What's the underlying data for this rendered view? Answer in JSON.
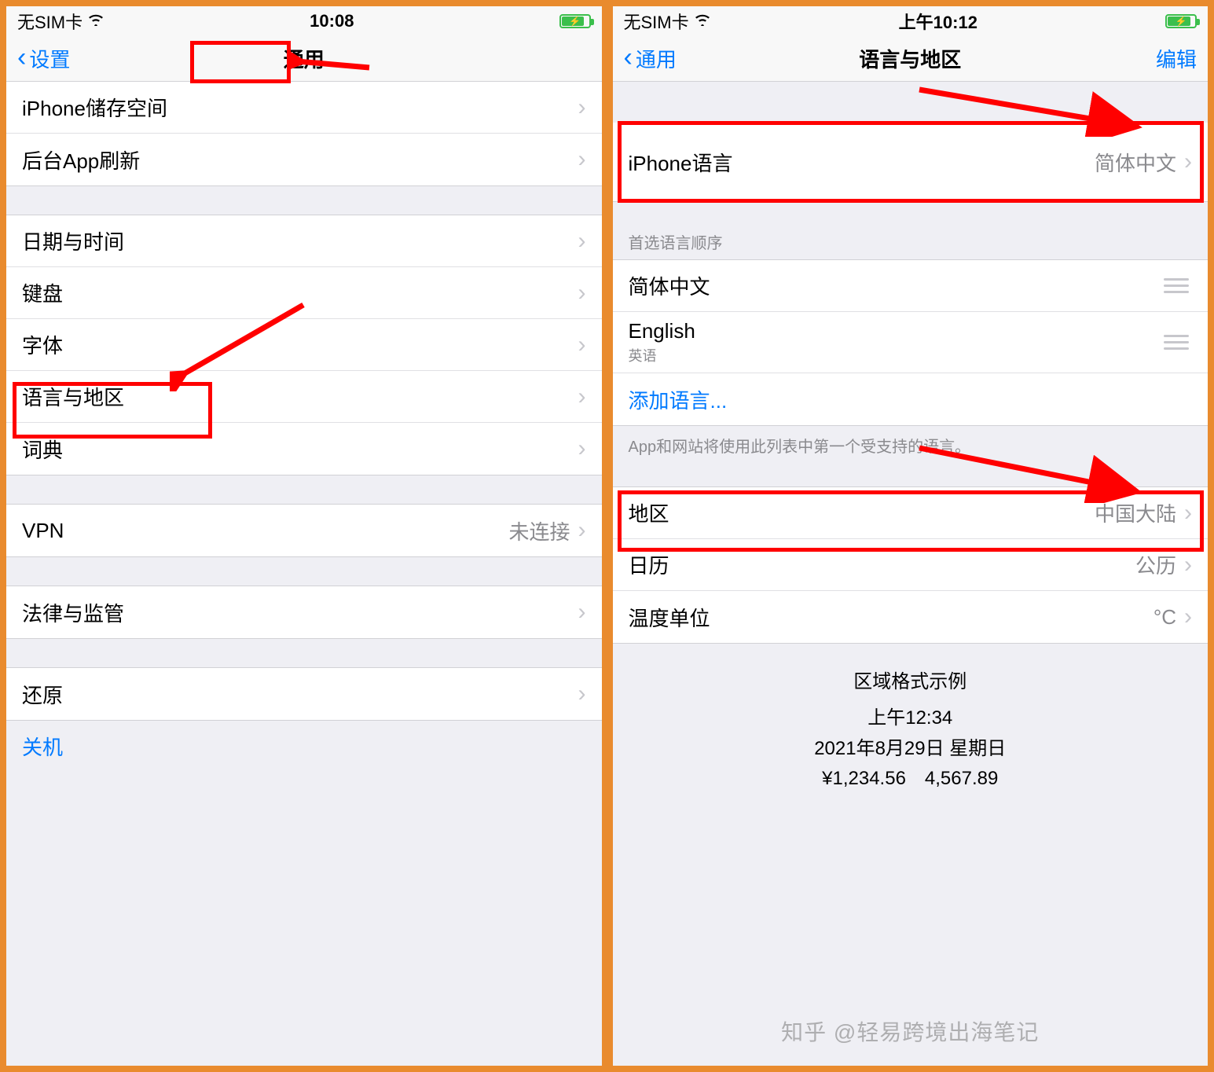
{
  "left": {
    "status": {
      "carrier": "无SIM卡",
      "time": "10:08"
    },
    "nav": {
      "back": "设置",
      "title": "通用"
    },
    "group1": [
      {
        "label": "iPhone储存空间"
      },
      {
        "label": "后台App刷新"
      }
    ],
    "group2": [
      {
        "label": "日期与时间"
      },
      {
        "label": "键盘"
      },
      {
        "label": "字体"
      },
      {
        "label": "语言与地区"
      },
      {
        "label": "词典"
      }
    ],
    "group3": [
      {
        "label": "VPN",
        "value": "未连接"
      }
    ],
    "group4": [
      {
        "label": "法律与监管"
      }
    ],
    "group5": [
      {
        "label": "还原"
      }
    ],
    "shutdown": "关机"
  },
  "right": {
    "status": {
      "carrier": "无SIM卡",
      "time": "上午10:12"
    },
    "nav": {
      "back": "通用",
      "title": "语言与地区",
      "action": "编辑"
    },
    "iphoneLang": {
      "label": "iPhone语言",
      "value": "简体中文"
    },
    "prefHeader": "首选语言顺序",
    "prefLangs": [
      {
        "label": "简体中文",
        "sub": ""
      },
      {
        "label": "English",
        "sub": "英语"
      }
    ],
    "addLang": "添加语言...",
    "prefFooter": "App和网站将使用此列表中第一个受支持的语言。",
    "region": [
      {
        "label": "地区",
        "value": "中国大陆"
      },
      {
        "label": "日历",
        "value": "公历"
      },
      {
        "label": "温度单位",
        "value": "°C"
      }
    ],
    "example": {
      "hdr": "区域格式示例",
      "l1": "上午12:34",
      "l2": "2021年8月29日 星期日",
      "l3": "¥1,234.56　4,567.89"
    }
  },
  "watermark": "知乎 @轻易跨境出海笔记"
}
